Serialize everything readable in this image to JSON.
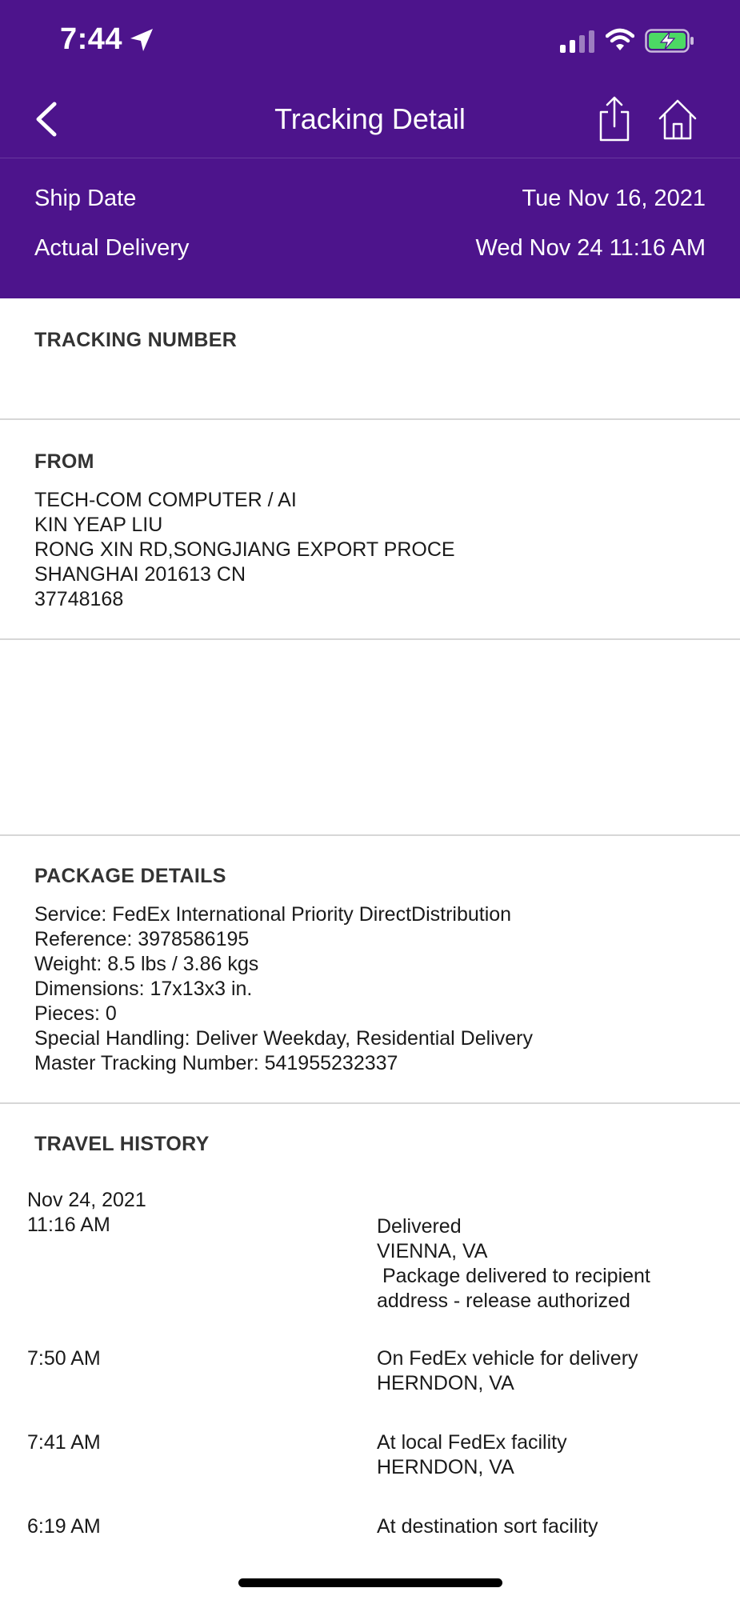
{
  "status_bar": {
    "time": "7:44"
  },
  "nav": {
    "title": "Tracking Detail"
  },
  "summary": {
    "ship_date_label": "Ship Date",
    "ship_date_value": "Tue Nov 16, 2021",
    "delivery_label": "Actual Delivery",
    "delivery_value": "Wed Nov 24 11:16 AM"
  },
  "tracking": {
    "title": "TRACKING NUMBER"
  },
  "from": {
    "title": "FROM",
    "lines": [
      "TECH-COM COMPUTER / AI",
      "KIN YEAP LIU",
      "RONG XIN RD,SONGJIANG EXPORT PROCE",
      "SHANGHAI 201613 CN",
      "37748168"
    ]
  },
  "package": {
    "title": "PACKAGE DETAILS",
    "lines": [
      "Service: FedEx International Priority DirectDistribution",
      "Reference: 3978586195",
      "Weight: 8.5 lbs / 3.86 kgs",
      "Dimensions: 17x13x3 in.",
      "Pieces: 0",
      "Special Handling: Deliver Weekday, Residential Delivery",
      "Master Tracking Number: 541955232337"
    ]
  },
  "history": {
    "title": "TRAVEL HISTORY",
    "date": "Nov 24, 2021",
    "events": [
      {
        "time": "11:16 AM",
        "lines": [
          "Delivered",
          "VIENNA, VA",
          " Package delivered to recipient",
          "address - release authorized"
        ]
      },
      {
        "time": "7:50 AM",
        "lines": [
          "On FedEx vehicle for delivery",
          "HERNDON, VA"
        ]
      },
      {
        "time": "7:41 AM",
        "lines": [
          "At local FedEx facility",
          "HERNDON, VA"
        ]
      },
      {
        "time": "6:19 AM",
        "lines": [
          "At destination sort facility"
        ]
      }
    ]
  },
  "colors": {
    "brand_purple": "#4d148c",
    "battery_green": "#4cd964",
    "divider": "#d7d7d7"
  }
}
